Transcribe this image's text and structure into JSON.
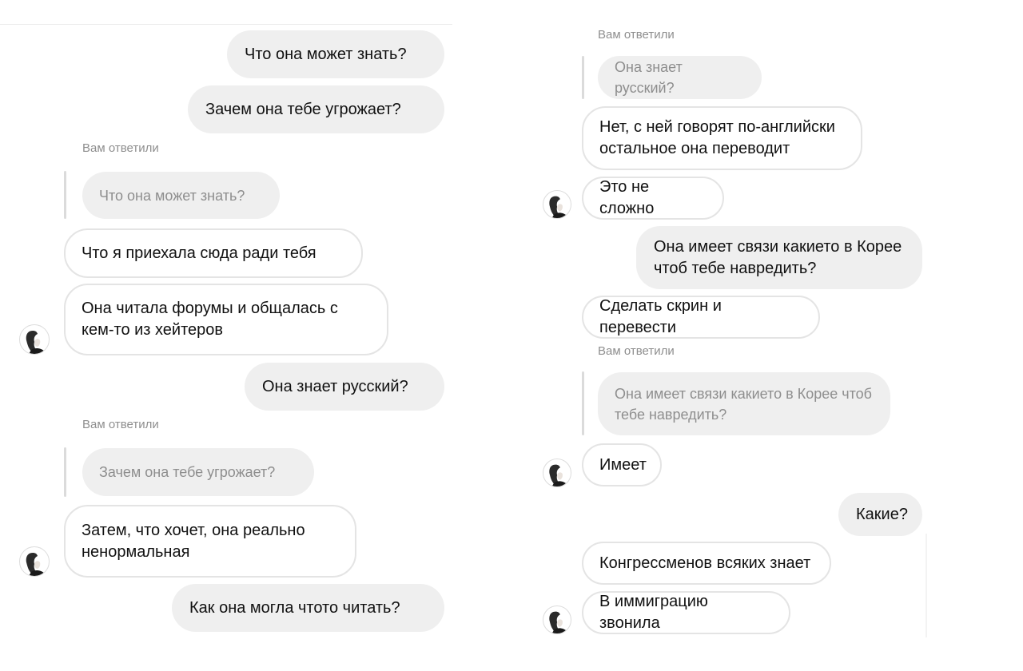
{
  "replied_label": "Вам ответили",
  "left": {
    "out_1": "Что она может знать?",
    "out_2": "Зачем она тебе угрожает?",
    "quote_1": "Что она может знать?",
    "in_1": "Что я приехала сюда ради тебя",
    "in_2": "Она читала форумы и общалась с\nкем-то из хейтеров",
    "out_3": "Она знает русский?",
    "quote_2": "Зачем она тебе угрожает?",
    "in_3": "Затем, что хочет, она реально\nненормальная",
    "out_4": "Как она могла чтото читать?"
  },
  "right": {
    "quote_1": "Она знает русский?",
    "in_1": "Нет, с ней говорят по-английски\nостальное она переводит",
    "in_2": "Это не сложно",
    "out_1": "Она имеет связи какието в Корее\nчтоб тебе навредить?",
    "in_3": "Сделать скрин и перевести",
    "quote_2": "Она имеет связи какието в Корее чтоб\nтебе навредить?",
    "in_4": "Имеет",
    "out_2": "Какие?",
    "in_5": "Конгрессменов всяких знает",
    "in_6": "В иммиграцию звонила"
  },
  "avatar_icon": "profile-avatar-icon"
}
